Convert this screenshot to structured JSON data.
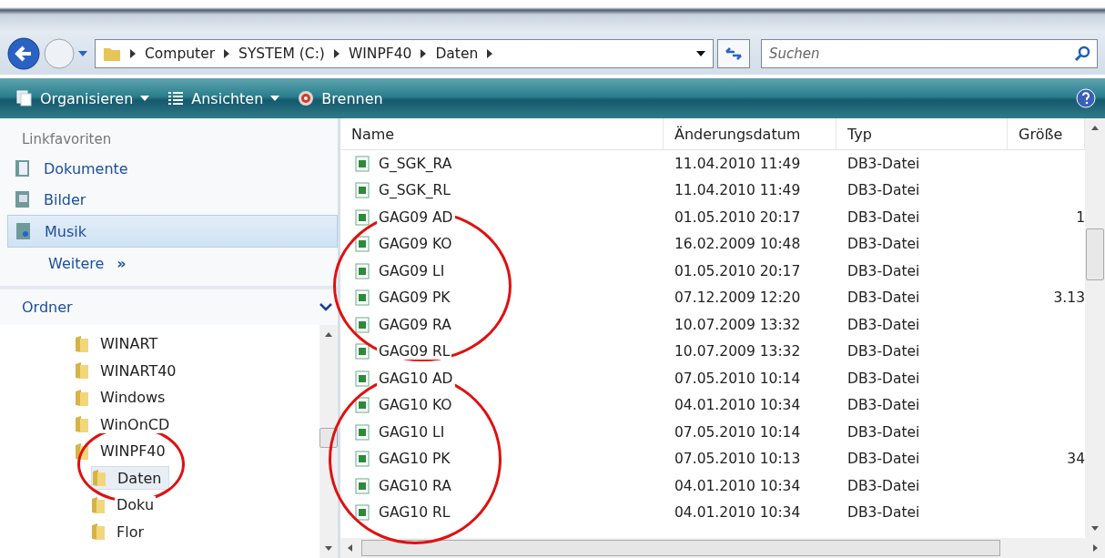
{
  "address_bar": {
    "crumbs": [
      "Computer",
      "SYSTEM (C:)",
      "WINPF40",
      "Daten"
    ]
  },
  "search": {
    "placeholder": "Suchen"
  },
  "toolbar": {
    "items": [
      {
        "kind": "organize",
        "label": "Organisieren",
        "dropdown": true
      },
      {
        "kind": "views",
        "label": "Ansichten",
        "dropdown": true
      },
      {
        "kind": "burn",
        "label": "Brennen",
        "dropdown": false
      }
    ]
  },
  "sidebar": {
    "favorites_title": "Linkfavoriten",
    "favorites": [
      {
        "kind": "documents",
        "label": "Dokumente",
        "selected": false
      },
      {
        "kind": "pictures",
        "label": "Bilder",
        "selected": false
      },
      {
        "kind": "music",
        "label": "Musik",
        "selected": true
      }
    ],
    "more": "Weitere",
    "more_glyph": "»",
    "folders_title": "Ordner",
    "folders": [
      {
        "label": "WINART",
        "selected": false
      },
      {
        "label": "WINART40",
        "selected": false
      },
      {
        "label": "Windows",
        "selected": false
      },
      {
        "label": "WinOnCD",
        "selected": false
      },
      {
        "label": "WINPF40",
        "selected": false,
        "children": [
          {
            "label": "Daten",
            "selected": true
          },
          {
            "label": "Doku",
            "selected": false
          },
          {
            "label": "Flor",
            "selected": false
          }
        ]
      }
    ]
  },
  "table": {
    "columns": [
      "Name",
      "Änderungsdatum",
      "Typ",
      "Größe"
    ],
    "rows": [
      {
        "name": "G_SGK_RA",
        "date": "11.04.2010 11:49",
        "type": "DB3-Datei"
      },
      {
        "name": "G_SGK_RL",
        "date": "11.04.2010 11:49",
        "type": "DB3-Datei"
      },
      {
        "name": "GAG09 AD",
        "date": "01.05.2010 20:17",
        "type": "DB3-Datei",
        "size": "1"
      },
      {
        "name": "GAG09 KO",
        "date": "16.02.2009 10:48",
        "type": "DB3-Datei"
      },
      {
        "name": "GAG09 LI",
        "date": "01.05.2010 20:17",
        "type": "DB3-Datei"
      },
      {
        "name": "GAG09 PK",
        "date": "07.12.2009 12:20",
        "type": "DB3-Datei",
        "size": "3.13"
      },
      {
        "name": "GAG09 RA",
        "date": "10.07.2009 13:32",
        "type": "DB3-Datei"
      },
      {
        "name": "GAG09 RL",
        "date": "10.07.2009 13:32",
        "type": "DB3-Datei"
      },
      {
        "name": "GAG10 AD",
        "date": "07.05.2010 10:14",
        "type": "DB3-Datei"
      },
      {
        "name": "GAG10 KO",
        "date": "04.01.2010 10:34",
        "type": "DB3-Datei"
      },
      {
        "name": "GAG10 LI",
        "date": "07.05.2010 10:14",
        "type": "DB3-Datei"
      },
      {
        "name": "GAG10 PK",
        "date": "07.05.2010 10:13",
        "type": "DB3-Datei",
        "size": "34"
      },
      {
        "name": "GAG10 RA",
        "date": "04.01.2010 10:34",
        "type": "DB3-Datei"
      },
      {
        "name": "GAG10 RL",
        "date": "04.01.2010 10:34",
        "type": "DB3-Datei"
      }
    ]
  }
}
